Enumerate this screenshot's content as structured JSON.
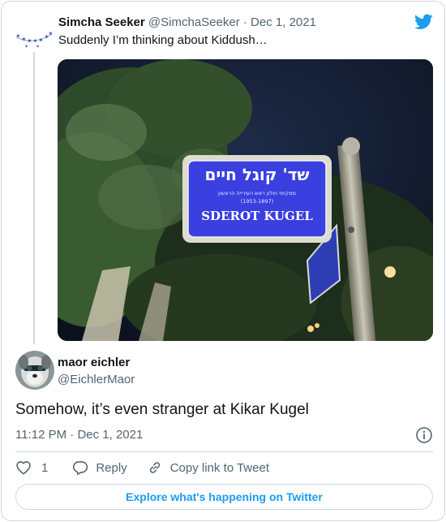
{
  "parent_tweet": {
    "author_name": "Simcha Seeker",
    "author_handle": "@SimchaSeeker",
    "separator": "·",
    "date": "Dec 1, 2021",
    "text": "Suddenly I’m thinking about Kiddush…",
    "photo": {
      "sign_hebrew_main": "שד' קוגל חיים",
      "sign_hebrew_sub": "ממקימי חולון ראש העירייה הראשון",
      "sign_years": "(1953-1897)",
      "sign_english": "SDEROT KUGEL"
    },
    "avatar_icon": "star-garland-icon"
  },
  "main_tweet": {
    "author_name": "maor eichler",
    "author_handle": "@EichlerMaor",
    "text": "Somehow, it’s even stranger at Kikar Kugel",
    "time": "11:12 PM",
    "separator": "·",
    "date": "Dec 1, 2021",
    "avatar_icon": "dog-avatar-icon"
  },
  "actions": {
    "like_count": "1",
    "reply_label": "Reply",
    "copy_link_label": "Copy link to Tweet"
  },
  "explore_label": "Explore what's happening on Twitter",
  "colors": {
    "accent": "#1d9bf0",
    "secondary_text": "#536471",
    "border": "#cfd9de"
  }
}
